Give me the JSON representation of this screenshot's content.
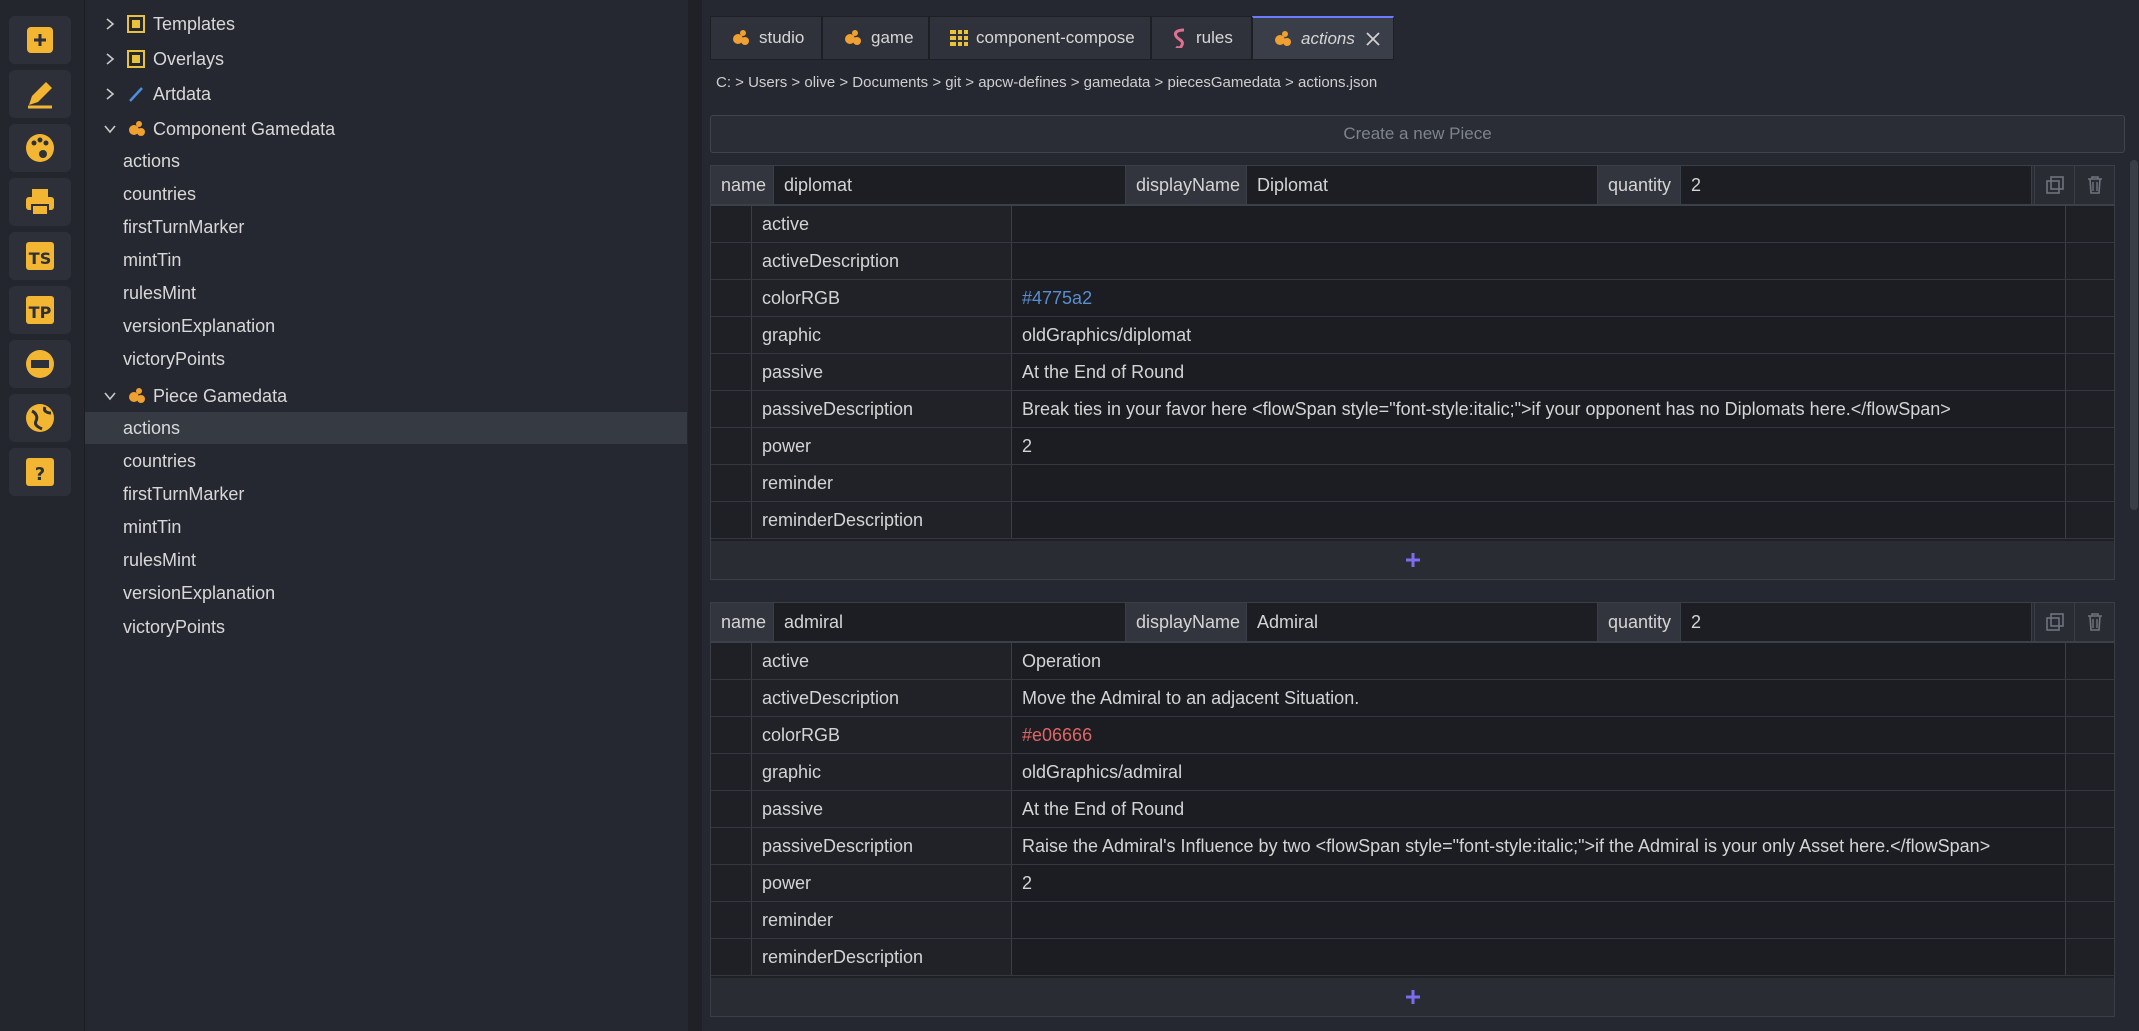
{
  "rail": {
    "icons": [
      "add-icon",
      "pencil-icon",
      "palette-icon",
      "printer-icon",
      "ts-icon",
      "tp-icon",
      "game-crafter-icon",
      "globe-icon",
      "help-icon"
    ]
  },
  "tree": {
    "templates": "Templates",
    "overlays": "Overlays",
    "artdata": "Artdata",
    "component_gamedata": {
      "label": "Component Gamedata",
      "items": [
        "actions",
        "countries",
        "firstTurnMarker",
        "mintTin",
        "rulesMint",
        "versionExplanation",
        "victoryPoints"
      ]
    },
    "piece_gamedata": {
      "label": "Piece Gamedata",
      "items": [
        "actions",
        "countries",
        "firstTurnMarker",
        "mintTin",
        "rulesMint",
        "versionExplanation",
        "victoryPoints"
      ]
    }
  },
  "tabs": [
    "studio",
    "game",
    "component-compose",
    "rules",
    "actions"
  ],
  "breadcrumb": "C: > Users > olive > Documents > git > apcw-defines > gamedata > piecesGamedata > actions.json",
  "create_placeholder": "Create a new Piece",
  "header_labels": {
    "name": "name",
    "displayName": "displayName",
    "quantity": "quantity"
  },
  "colors": {
    "accent": "#6b7cff",
    "icon_orange": "#f0a030",
    "icon_yellow": "#f2b632",
    "plus": "#7b6cf0"
  },
  "pieces": [
    {
      "name": "diplomat",
      "displayName": "Diplomat",
      "quantity": "2",
      "props": [
        {
          "key": "active",
          "value": ""
        },
        {
          "key": "activeDescription",
          "value": ""
        },
        {
          "key": "colorRGB",
          "value": "#4775a2"
        },
        {
          "key": "graphic",
          "value": "oldGraphics/diplomat"
        },
        {
          "key": "passive",
          "value": "At the End of Round"
        },
        {
          "key": "passiveDescription",
          "value": "Break ties in your favor here <flowSpan style=\"font-style:italic;\">if your opponent has no Diplomats here.</flowSpan>"
        },
        {
          "key": "power",
          "value": "2"
        },
        {
          "key": "reminder",
          "value": ""
        },
        {
          "key": "reminderDescription",
          "value": ""
        }
      ]
    },
    {
      "name": "admiral",
      "displayName": "Admiral",
      "quantity": "2",
      "props": [
        {
          "key": "active",
          "value": "Operation"
        },
        {
          "key": "activeDescription",
          "value": "Move the Admiral to an adjacent Situation."
        },
        {
          "key": "colorRGB",
          "value": "#e06666"
        },
        {
          "key": "graphic",
          "value": "oldGraphics/admiral"
        },
        {
          "key": "passive",
          "value": "At the End of Round"
        },
        {
          "key": "passiveDescription",
          "value": "Raise the Admiral's Influence by two <flowSpan style=\"font-style:italic;\">if the Admiral is your only Asset here.</flowSpan>"
        },
        {
          "key": "power",
          "value": "2"
        },
        {
          "key": "reminder",
          "value": ""
        },
        {
          "key": "reminderDescription",
          "value": ""
        }
      ]
    }
  ]
}
